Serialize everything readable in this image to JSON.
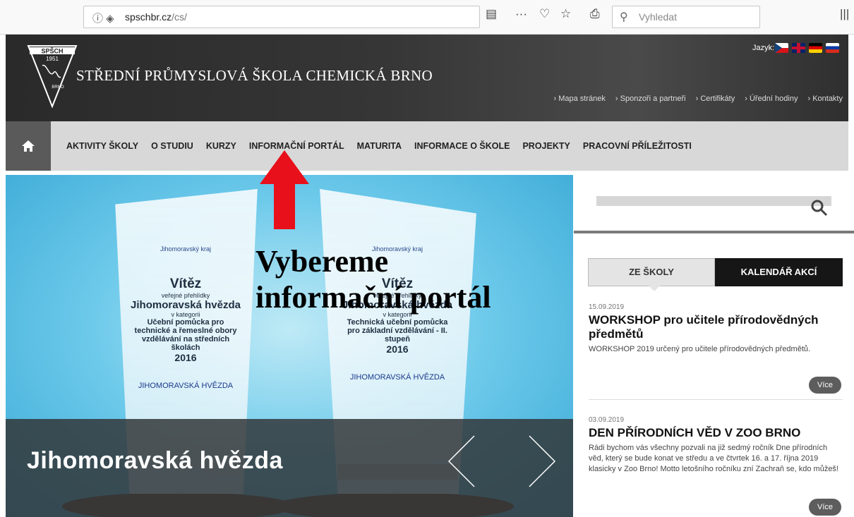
{
  "browser": {
    "url_domain": "spschbr.cz",
    "url_path": "/cs/",
    "search_placeholder": "Vyhledat"
  },
  "header": {
    "logo_top": "SPŠCH",
    "logo_year": "1951",
    "logo_side": "BRNO",
    "school_name": "STŘEDNÍ PRŮMYSLOVÁ ŠKOLA CHEMICKÁ BRNO",
    "language_label": "Jazyk:",
    "top_links": [
      "Mapa stránek",
      "Sponzoři a partneři",
      "Certifikáty",
      "Úřední hodiny",
      "Kontakty"
    ]
  },
  "nav": {
    "items": [
      "AKTIVITY ŠKOLY",
      "O STUDIU",
      "KURZY",
      "INFORMAČNÍ PORTÁL",
      "MATURITA",
      "INFORMACE O ŠKOLE",
      "PROJEKTY",
      "PRACOVNÍ PŘÍLEŽITOSTI"
    ]
  },
  "slider": {
    "caption": "Jihomoravská hvězda",
    "trophy1": {
      "org": "Jihomoravský kraj",
      "title": "Vítěz",
      "sub1": "veřejné přehlídky",
      "name": "Jihomoravská hvězda",
      "sub2": "v kategorii",
      "desc": "Učební pomůcka pro technické a řemeslné obory vzdělávání na středních školách",
      "year": "2016",
      "brand": "JIHOMORAVSKÁ HVĚZDA"
    },
    "trophy2": {
      "org": "Jihomoravský kraj",
      "title": "Vítěz",
      "sub1": "veřejné přehlídky",
      "name": "Jihomoravská hvězda",
      "sub2": "v kategorii",
      "desc": "Technická učební pomůcka pro základní vzdělávání - II. stupeň",
      "year": "2016",
      "brand": "JIHOMORAVSKÁ HVĚZDA"
    }
  },
  "annotation": {
    "line1": "Vybereme",
    "line2": "informační portál"
  },
  "sidebar": {
    "tab_school": "ZE ŠKOLY",
    "tab_calendar": "KALENDÁŘ AKCÍ",
    "news": [
      {
        "date": "15.09.2019",
        "title": "WORKSHOP pro učitele přírodovědných předmětů",
        "text": "WORKSHOP 2019 určený pro učitele přírodovědných předmětů.",
        "more": "Více"
      },
      {
        "date": "03.09.2019",
        "title": "DEN PŘÍRODNÍCH VĚD V ZOO BRNO",
        "text": "Rádi bychom vás všechny pozvali na již sedmý ročník Dne přírodních věd, který se bude konat ve středu a ve čtvrtek 16. a 17. října 2019 klasicky v Zoo Brno! Motto letošního ročníku zní Zachraň se, kdo můžeš!",
        "more": "Více"
      }
    ]
  },
  "colors": {
    "header_bg": "#2f2f2f",
    "nav_bg": "#d8d8d8",
    "home_bg": "#5a5a5a",
    "arrow_red": "#e8101a",
    "tab_active": "#161616"
  }
}
